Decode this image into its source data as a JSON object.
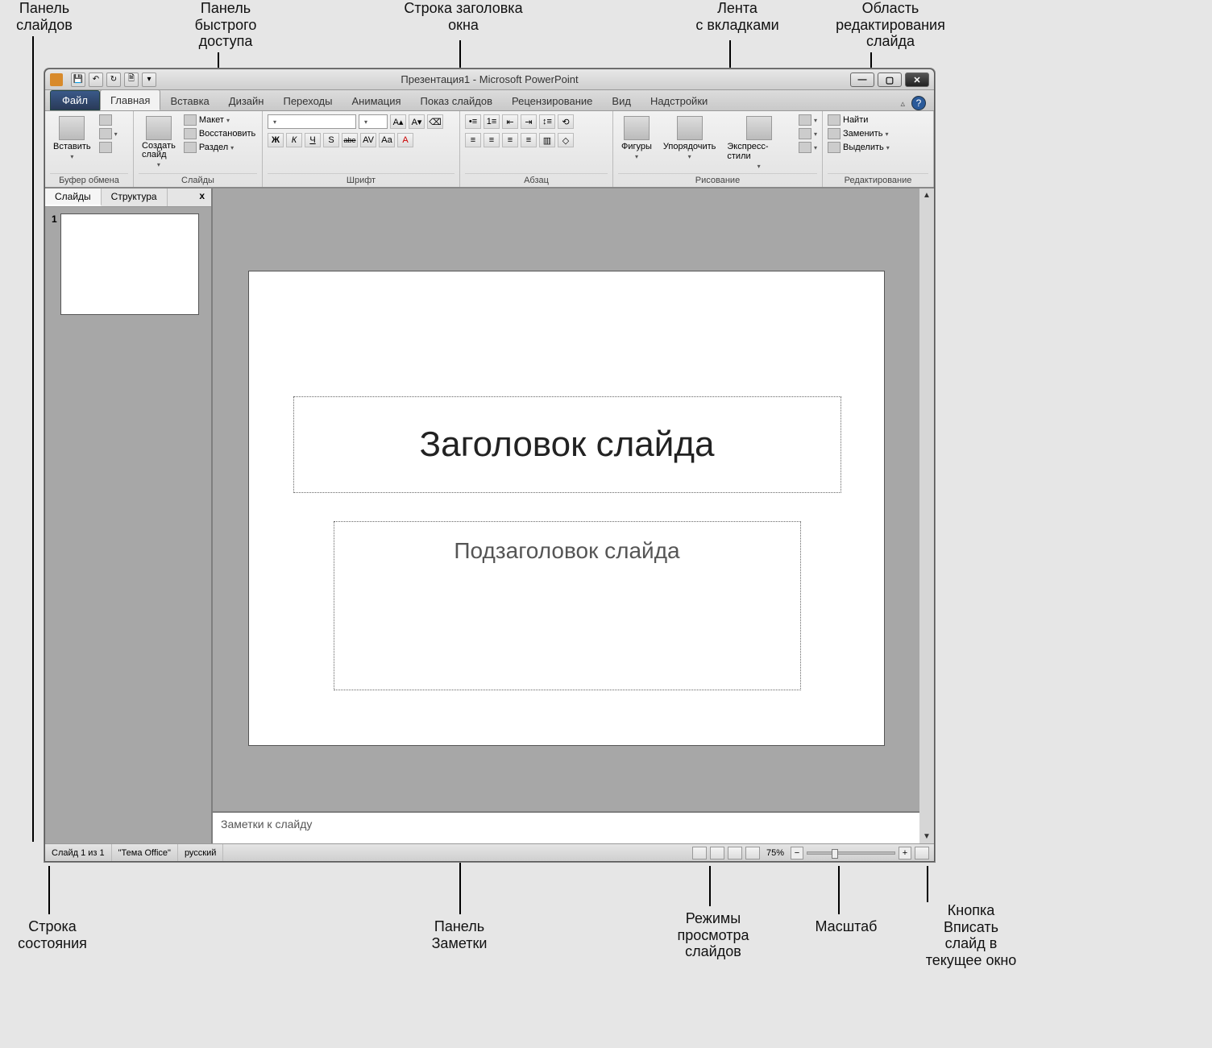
{
  "callouts": {
    "slide_panel": "Панель\nслайдов",
    "qat": "Панель\nбыстрого\nдоступа",
    "title_bar": "Строка заголовка\nокна",
    "ribbon_tabs": "Лента\nс вкладками",
    "edit_area": "Область\nредактирования\nслайда",
    "status_bar": "Строка\nсостояния",
    "notes_panel": "Панель\nЗаметки",
    "view_modes": "Режимы\nпросмотра\nслайдов",
    "zoom": "Масштаб",
    "fit_button": "Кнопка\nВписать\nслайд в\nтекущее окно"
  },
  "titlebar": {
    "doc": "Презентация1",
    "app": "Microsoft PowerPoint"
  },
  "tabs": {
    "file": "Файл",
    "items": [
      "Главная",
      "Вставка",
      "Дизайн",
      "Переходы",
      "Анимация",
      "Показ слайдов",
      "Рецензирование",
      "Вид",
      "Надстройки"
    ],
    "active": 0,
    "minimize_ribbon": "▵",
    "help": "?"
  },
  "ribbon": {
    "clipboard": {
      "label": "Буфер обмена",
      "paste": "Вставить"
    },
    "slides": {
      "label": "Слайды",
      "new_slide": "Создать\nслайд",
      "layout": "Макет",
      "reset": "Восстановить",
      "section": "Раздел"
    },
    "font": {
      "label": "Шрифт",
      "format_buttons": [
        "Ж",
        "К",
        "Ч",
        "S",
        "abe",
        "AV",
        "Aa",
        "A"
      ],
      "size_buttons": [
        "A▴",
        "A▾"
      ]
    },
    "paragraph": {
      "label": "Абзац"
    },
    "drawing": {
      "label": "Рисование",
      "shapes": "Фигуры",
      "arrange": "Упорядочить",
      "styles": "Экспресс-стили"
    },
    "editing": {
      "label": "Редактирование",
      "find": "Найти",
      "replace": "Заменить",
      "select": "Выделить"
    }
  },
  "slide_panel": {
    "tabs": [
      "Слайды",
      "Структура"
    ],
    "close": "x",
    "thumb_num": "1"
  },
  "slide": {
    "title_ph": "Заголовок слайда",
    "subtitle_ph": "Подзаголовок слайда"
  },
  "notes": {
    "placeholder": "Заметки к слайду"
  },
  "statusbar": {
    "slide_count": "Слайд 1 из 1",
    "theme": "\"Тема Office\"",
    "lang": "русский",
    "zoom_pct": "75%"
  }
}
